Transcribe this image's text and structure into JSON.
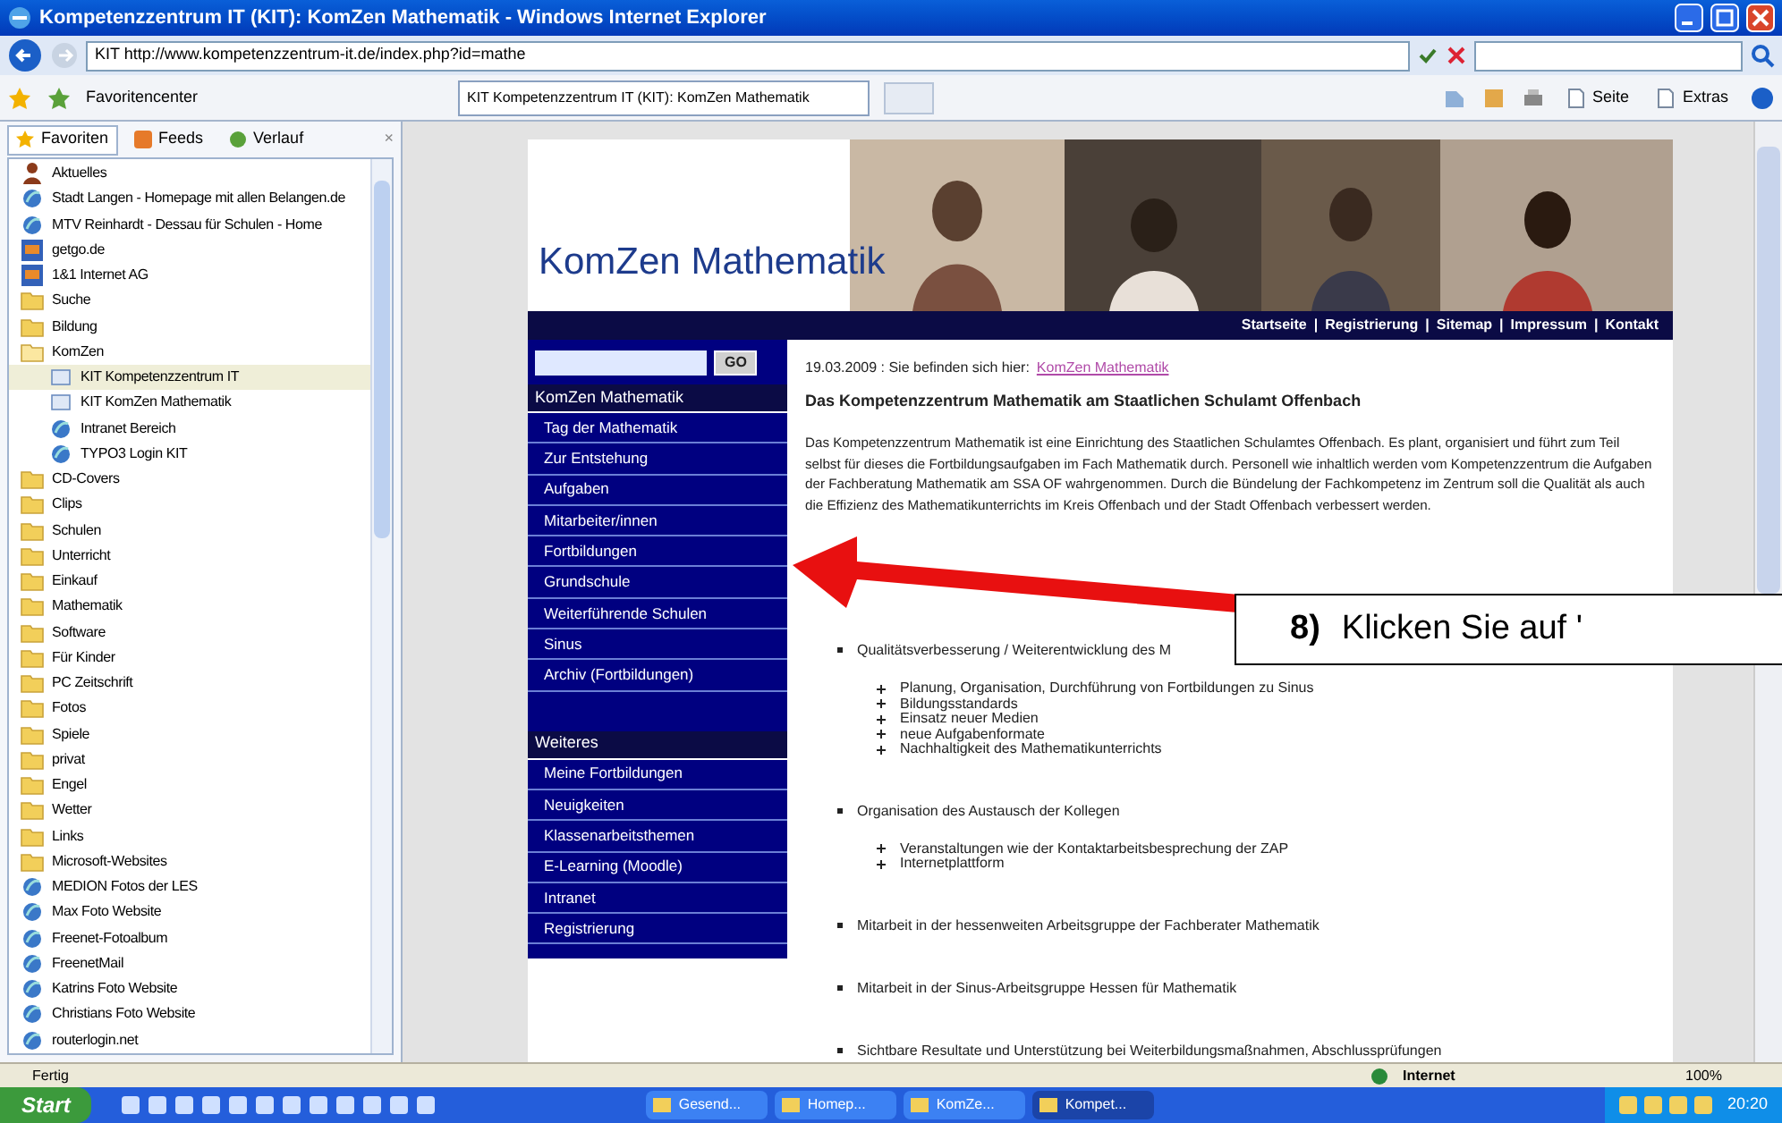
{
  "window": {
    "title": "Kompetenzzentrum IT (KIT): KomZen Mathematik - Windows Internet Explorer"
  },
  "address_bar": {
    "url": "KIT http://www.kompetenzzentrum-it.de/index.php?id=mathe"
  },
  "favorites_bar": {
    "label": "Favoritencenter",
    "tab": "KIT Kompetenzzentrum IT (KIT): KomZen Mathematik"
  },
  "command_bar": [
    "Seite",
    "Extras"
  ],
  "favorites_panel": {
    "tabs": [
      {
        "label": "Favoriten",
        "selected": true
      },
      {
        "label": "Feeds",
        "selected": false
      },
      {
        "label": "Verlauf",
        "selected": false
      }
    ],
    "close": "×",
    "items": [
      {
        "label": "Aktuelles",
        "kind": "user",
        "selected": false
      },
      {
        "label": "Stadt Langen - Homepage mit allen Belangen.de",
        "kind": "link",
        "selected": false
      },
      {
        "label": "MTV Reinhardt - Dessau für Schulen - Home",
        "kind": "link",
        "selected": false
      },
      {
        "label": "getgo.de",
        "kind": "tile",
        "selected": false
      },
      {
        "label": "1&1 Internet AG",
        "kind": "tile",
        "selected": false
      },
      {
        "label": "Suche",
        "kind": "folder",
        "selected": false
      },
      {
        "label": "Bildung",
        "kind": "folder",
        "selected": false
      },
      {
        "label": "KomZen",
        "kind": "folder",
        "selected": false,
        "expanded": true,
        "children": [
          {
            "label": "KIT Kompetenzzentrum IT",
            "kind": "page",
            "selected": true
          },
          {
            "label": "KIT KomZen Mathematik",
            "kind": "page",
            "selected": false
          },
          {
            "label": "Intranet Bereich",
            "kind": "link",
            "selected": false
          },
          {
            "label": "TYPO3 Login KIT",
            "kind": "link",
            "selected": false
          }
        ]
      },
      {
        "label": "CD-Covers",
        "kind": "folder",
        "selected": false
      },
      {
        "label": "Clips",
        "kind": "folder",
        "selected": false
      },
      {
        "label": "Schulen",
        "kind": "folder",
        "selected": false
      },
      {
        "label": "Unterricht",
        "kind": "folder",
        "selected": false
      },
      {
        "label": "Einkauf",
        "kind": "folder",
        "selected": false
      },
      {
        "label": "Mathematik",
        "kind": "folder",
        "selected": false
      },
      {
        "label": "Software",
        "kind": "folder",
        "selected": false
      },
      {
        "label": "Für Kinder",
        "kind": "folder",
        "selected": false
      },
      {
        "label": "PC Zeitschrift",
        "kind": "folder",
        "selected": false
      },
      {
        "label": "Fotos",
        "kind": "folder",
        "selected": false
      },
      {
        "label": "Spiele",
        "kind": "folder",
        "selected": false
      },
      {
        "label": "privat",
        "kind": "folder",
        "selected": false
      },
      {
        "label": "Engel",
        "kind": "folder",
        "selected": false
      },
      {
        "label": "Wetter",
        "kind": "folder",
        "selected": false
      },
      {
        "label": "Links",
        "kind": "folder",
        "selected": false
      },
      {
        "label": "Microsoft-Websites",
        "kind": "folder",
        "selected": false
      },
      {
        "label": "MEDION Fotos der LES",
        "kind": "link",
        "selected": false
      },
      {
        "label": "Max Foto Website",
        "kind": "link",
        "selected": false
      },
      {
        "label": "Freenet-Fotoalbum",
        "kind": "link",
        "selected": false
      },
      {
        "label": "FreenetMail",
        "kind": "link",
        "selected": false
      },
      {
        "label": "Katrins Foto Website",
        "kind": "link",
        "selected": false
      },
      {
        "label": "Christians Foto Website",
        "kind": "link",
        "selected": false
      },
      {
        "label": "routerlogin.net",
        "kind": "link",
        "selected": false
      }
    ]
  },
  "page": {
    "site_title": "KomZen Mathematik",
    "top_links": [
      "Startseite",
      "Registrierung",
      "Sitemap",
      "Impressum",
      "Kontakt"
    ],
    "link_separator": "|",
    "search_button": "GO",
    "nav_sections": [
      {
        "title": "KomZen Mathematik",
        "items": [
          "Tag der Mathematik",
          "Zur Entstehung",
          "Aufgaben",
          "Mitarbeiter/innen",
          "Fortbildungen",
          "Grundschule",
          "Weiterführende Schulen",
          "Sinus",
          "Archiv (Fortbildungen)"
        ]
      },
      {
        "title": "Weiteres",
        "items": [
          "Meine Fortbildungen",
          "Neuigkeiten",
          "Klassenarbeitsthemen",
          "E-Learning (Moodle)",
          "Intranet",
          "Registrierung"
        ]
      }
    ],
    "breadcrumb": {
      "text": "19.03.2009 : Sie befinden sich hier:",
      "link": "KomZen Mathematik"
    },
    "heading": "Das Kompetenzzentrum Mathematik am Staatlichen Schulamt Offenbach",
    "paragraph": "Das Kompetenzzentrum Mathematik ist eine Einrichtung des Staatlichen Schulamtes Offenbach. Es plant, organisiert und führt zum Teil selbst für dieses die Fortbildungsaufgaben im Fach Mathematik durch. Personell wie inhaltlich werden vom Kompetenzzentrum die Aufgaben der Fachberatung Mathematik am SSA OF wahrgenommen. Durch die Bündelung der Fachkompetenz im Zentrum soll die Qualität als auch die Effizienz des Mathematikunterrichts im Kreis Offenbach und der Stadt Offenbach verbessert werden.",
    "bullets": [
      {
        "text": "Qualitätsverbesserung / Weiterentwicklung des M",
        "children": [
          "Planung, Organisation, Durchführung von Fortbildungen zu Sinus",
          "Bildungsstandards",
          "Einsatz neuer Medien",
          "neue Aufgabenformate",
          "Nachhaltigkeit des Mathematikunterrichts"
        ]
      },
      {
        "text": "Organisation des Austausch der Kollegen",
        "children": [
          "Veranstaltungen wie der Kontaktarbeitsbesprechung der ZAP",
          "Internetplattform"
        ]
      },
      {
        "text": "Mitarbeit in der hessenweiten Arbeitsgruppe der Fachberater Mathematik"
      },
      {
        "text": "Mitarbeit in der Sinus-Arbeitsgruppe Hessen für Mathematik"
      },
      {
        "text": "Sichtbare Resultate und Unterstützung bei Weiterbildungsmaßnahmen, Abschlussprüfungen"
      }
    ]
  },
  "callout": {
    "number": "8)",
    "text": "Klicken Sie auf '"
  },
  "status_bar": {
    "text": "Fertig",
    "zone": "Internet",
    "zoom": "100%"
  },
  "taskbar": {
    "start": "Start",
    "tasks": [
      {
        "label": "Gesend...",
        "selected": false
      },
      {
        "label": "Homep...",
        "selected": false
      },
      {
        "label": "KomZe...",
        "selected": false
      },
      {
        "label": "Kompet...",
        "selected": true
      }
    ],
    "clock": "20:20"
  }
}
